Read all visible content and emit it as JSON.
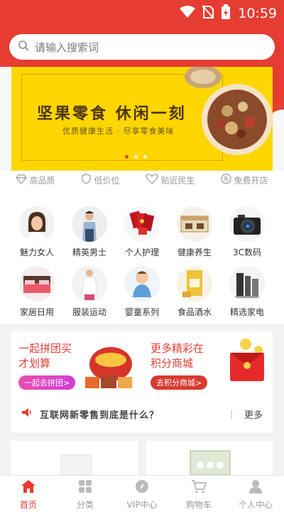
{
  "status": {
    "time": "10:59"
  },
  "search": {
    "placeholder": "请输入搜索词"
  },
  "banner": {
    "title": "坚果零食 休闲一刻",
    "subtitle": "优质健康生活 · 尽享零食美味"
  },
  "features": [
    "高品质",
    "低价位",
    "贴近民生",
    "免费开店"
  ],
  "categories": [
    {
      "label": "魅力女人",
      "icon": "woman-icon"
    },
    {
      "label": "精英男士",
      "icon": "man-icon"
    },
    {
      "label": "个人护理",
      "icon": "red-packets-icon"
    },
    {
      "label": "健康养生",
      "icon": "gift-box-icon"
    },
    {
      "label": "3C数码",
      "icon": "camera-icon"
    },
    {
      "label": "家居日用",
      "icon": "bed-icon"
    },
    {
      "label": "服装运动",
      "icon": "clothing-icon"
    },
    {
      "label": "婴童系列",
      "icon": "baby-icon"
    },
    {
      "label": "食品酒水",
      "icon": "food-package-icon"
    },
    {
      "label": "精选家电",
      "icon": "appliance-icon"
    }
  ],
  "promo": {
    "group_title_1": "一起拼团买",
    "group_title_2": "才划算",
    "group_button": "一起去拼团>",
    "points_title_1": "更多精彩在",
    "points_title_2": "积分商城",
    "points_button": "去积分商城>"
  },
  "news": {
    "text": "互联网新零售到底是什么？",
    "more": "更多"
  },
  "tabs": [
    {
      "label": "首页",
      "icon": "home-icon",
      "active": true
    },
    {
      "label": "分类",
      "icon": "grid-icon"
    },
    {
      "label": "VIP中心",
      "icon": "compass-icon"
    },
    {
      "label": "购物车",
      "icon": "cart-icon"
    },
    {
      "label": "个人中心",
      "icon": "person-icon"
    }
  ],
  "colors": {
    "primary": "#e53d32",
    "banner": "#fdd600"
  }
}
